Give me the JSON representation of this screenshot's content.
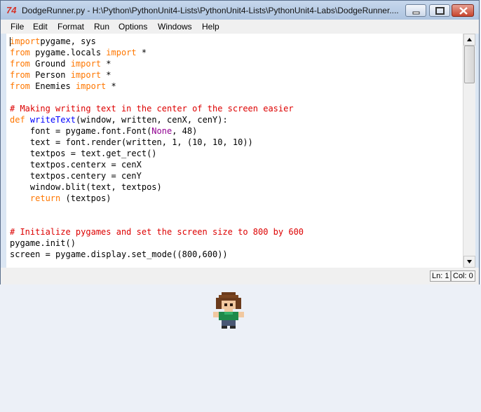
{
  "window": {
    "title": "DodgeRunner.py - H:\\Python\\PythonUnit4-Lists\\PythonUnit4-Lists\\PythonUnit4-Labs\\DodgeRunner....",
    "icon": "tk-feather-icon"
  },
  "menu": [
    "File",
    "Edit",
    "Format",
    "Run",
    "Options",
    "Windows",
    "Help"
  ],
  "editor": {
    "lines": [
      [
        [
          "kw",
          "import"
        ],
        [
          "",
          "pygame, sys"
        ]
      ],
      [
        [
          "kw",
          "from"
        ],
        [
          "",
          " pygame.locals "
        ],
        [
          "kw",
          "import"
        ],
        [
          "",
          " *"
        ]
      ],
      [
        [
          "kw",
          "from"
        ],
        [
          "",
          " Ground "
        ],
        [
          "kw",
          "import"
        ],
        [
          "",
          " *"
        ]
      ],
      [
        [
          "kw",
          "from"
        ],
        [
          "",
          " Person "
        ],
        [
          "kw",
          "import"
        ],
        [
          "",
          " *"
        ]
      ],
      [
        [
          "kw",
          "from"
        ],
        [
          "",
          " Enemies "
        ],
        [
          "kw",
          "import"
        ],
        [
          "",
          " *"
        ]
      ],
      [],
      [
        [
          "cm",
          "# Making writing text in the center of the screen easier"
        ]
      ],
      [
        [
          "kw",
          "def"
        ],
        [
          "",
          " "
        ],
        [
          "fn",
          "writeText"
        ],
        [
          "",
          "(window, written, cenX, cenY):"
        ]
      ],
      [
        [
          "",
          "    font = pygame.font.Font("
        ],
        [
          "bi",
          "None"
        ],
        [
          "",
          ", 48)"
        ]
      ],
      [
        [
          "",
          "    text = font.render(written, 1, (10, 10, 10))"
        ]
      ],
      [
        [
          "",
          "    textpos = text.get_rect()"
        ]
      ],
      [
        [
          "",
          "    textpos.centerx = cenX"
        ]
      ],
      [
        [
          "",
          "    textpos.centery = cenY"
        ]
      ],
      [
        [
          "",
          "    window.blit(text, textpos)"
        ]
      ],
      [
        [
          "",
          "    "
        ],
        [
          "kw",
          "return"
        ],
        [
          "",
          " (textpos)"
        ]
      ],
      [],
      [],
      [
        [
          "cm",
          "# Initialize pygames and set the screen size to 800 by 600"
        ]
      ],
      [
        [
          "",
          "pygame.init()"
        ]
      ],
      [
        [
          "",
          "screen = pygame.display.set_mode((800,600))"
        ]
      ]
    ]
  },
  "status": {
    "line": "Ln: 1",
    "col": "Col: 0"
  },
  "colors": {
    "keyword": "#ff7700",
    "comment": "#dd0000",
    "function": "#0000ff",
    "builtin": "#900090"
  }
}
